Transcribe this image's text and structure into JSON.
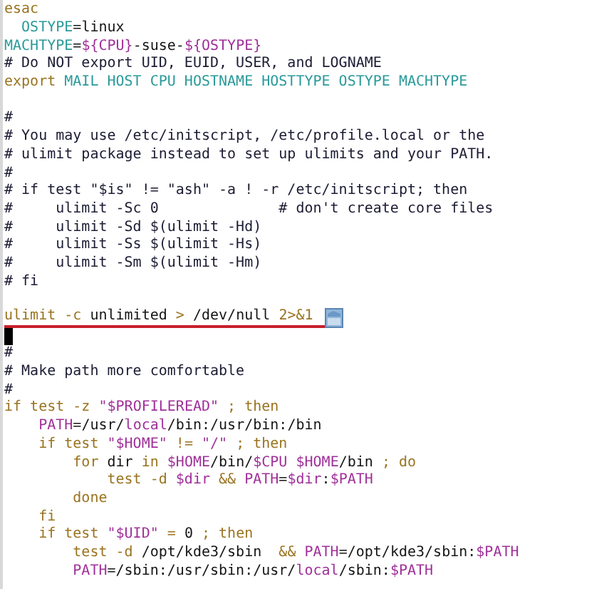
{
  "lines": [
    {
      "tokens": [
        {
          "text": "esac",
          "kind": "keyword"
        }
      ]
    },
    {
      "tokens": [
        {
          "text": "  OSTYPE",
          "kind": "variable"
        },
        {
          "text": "=linux",
          "kind": "plain"
        }
      ]
    },
    {
      "tokens": [
        {
          "text": "MACHTYPE",
          "kind": "variable"
        },
        {
          "text": "=",
          "kind": "plain"
        },
        {
          "text": "${CPU}",
          "kind": "expansion"
        },
        {
          "text": "-suse-",
          "kind": "plain"
        },
        {
          "text": "${OSTYPE}",
          "kind": "expansion"
        }
      ]
    },
    {
      "tokens": [
        {
          "text": "# Do NOT export UID, EUID, USER, and LOGNAME",
          "kind": "comment"
        }
      ]
    },
    {
      "tokens": [
        {
          "text": "export",
          "kind": "keyword"
        },
        {
          "text": " MAIL HOST CPU HOSTNAME HOSTTYPE OSTYPE MACHTYPE",
          "kind": "variable"
        }
      ]
    },
    {
      "kind": "blank"
    },
    {
      "tokens": [
        {
          "text": "#",
          "kind": "comment"
        }
      ]
    },
    {
      "tokens": [
        {
          "text": "# You may use /etc/initscript, /etc/profile.local or the",
          "kind": "comment"
        }
      ]
    },
    {
      "tokens": [
        {
          "text": "# ulimit package instead to set up ulimits and your PATH.",
          "kind": "comment"
        }
      ]
    },
    {
      "tokens": [
        {
          "text": "#",
          "kind": "comment"
        }
      ]
    },
    {
      "tokens": [
        {
          "text": "# if test \"$is\" != \"ash\" -a ! -r /etc/initscript; then",
          "kind": "comment"
        }
      ]
    },
    {
      "tokens": [
        {
          "text": "#     ulimit -Sc 0              # don't create core files",
          "kind": "comment"
        }
      ]
    },
    {
      "tokens": [
        {
          "text": "#     ulimit -Sd $(ulimit -Hd)",
          "kind": "comment"
        }
      ]
    },
    {
      "tokens": [
        {
          "text": "#     ulimit -Ss $(ulimit -Hs)",
          "kind": "comment"
        }
      ]
    },
    {
      "tokens": [
        {
          "text": "#     ulimit -Sm $(ulimit -Hm)",
          "kind": "comment"
        }
      ]
    },
    {
      "tokens": [
        {
          "text": "# fi",
          "kind": "comment"
        }
      ]
    },
    {
      "kind": "blank"
    },
    {
      "underlined": true,
      "marker": true,
      "tokens": [
        {
          "text": "ulimit",
          "kind": "keyword"
        },
        {
          "text": " -c",
          "kind": "keyword"
        },
        {
          "text": " unlimited ",
          "kind": "plain"
        },
        {
          "text": ">",
          "kind": "keyword"
        },
        {
          "text": " /dev/null ",
          "kind": "plain"
        },
        {
          "text": "2>&1",
          "kind": "keyword"
        }
      ]
    },
    {
      "kind": "cursor"
    },
    {
      "tokens": [
        {
          "text": "#",
          "kind": "comment"
        }
      ]
    },
    {
      "tokens": [
        {
          "text": "# Make path more comfortable",
          "kind": "comment"
        }
      ]
    },
    {
      "tokens": [
        {
          "text": "#",
          "kind": "comment"
        }
      ]
    },
    {
      "tokens": [
        {
          "text": "if test -z ",
          "kind": "keyword"
        },
        {
          "text": "\"$PROFILEREAD\"",
          "kind": "expansion"
        },
        {
          "text": " ; then",
          "kind": "keyword"
        }
      ]
    },
    {
      "tokens": [
        {
          "text": "    PATH",
          "kind": "expansion"
        },
        {
          "text": "=/usr/",
          "kind": "plain"
        },
        {
          "text": "local",
          "kind": "expansion"
        },
        {
          "text": "/bin:/usr/bin:/bin",
          "kind": "plain"
        }
      ]
    },
    {
      "tokens": [
        {
          "text": "    if test ",
          "kind": "keyword"
        },
        {
          "text": "\"$HOME\"",
          "kind": "expansion"
        },
        {
          "text": " != ",
          "kind": "keyword"
        },
        {
          "text": "\"/\"",
          "kind": "expansion"
        },
        {
          "text": " ; then",
          "kind": "keyword"
        }
      ]
    },
    {
      "tokens": [
        {
          "text": "        for",
          "kind": "keyword"
        },
        {
          "text": " dir ",
          "kind": "plain"
        },
        {
          "text": "in",
          "kind": "keyword"
        },
        {
          "text": " $HOME",
          "kind": "expansion"
        },
        {
          "text": "/bin/",
          "kind": "plain"
        },
        {
          "text": "$CPU",
          "kind": "expansion"
        },
        {
          "text": " $HOME",
          "kind": "expansion"
        },
        {
          "text": "/bin ",
          "kind": "plain"
        },
        {
          "text": "; do",
          "kind": "keyword"
        }
      ]
    },
    {
      "tokens": [
        {
          "text": "            test -d",
          "kind": "keyword"
        },
        {
          "text": " $dir",
          "kind": "expansion"
        },
        {
          "text": " &&",
          "kind": "keyword"
        },
        {
          "text": " PATH",
          "kind": "expansion"
        },
        {
          "text": "=",
          "kind": "plain"
        },
        {
          "text": "$dir",
          "kind": "expansion"
        },
        {
          "text": ":",
          "kind": "plain"
        },
        {
          "text": "$PATH",
          "kind": "expansion"
        }
      ]
    },
    {
      "tokens": [
        {
          "text": "        done",
          "kind": "keyword"
        }
      ]
    },
    {
      "tokens": [
        {
          "text": "    fi",
          "kind": "keyword"
        }
      ]
    },
    {
      "tokens": [
        {
          "text": "    if test ",
          "kind": "keyword"
        },
        {
          "text": "\"$UID\"",
          "kind": "expansion"
        },
        {
          "text": " = ",
          "kind": "keyword"
        },
        {
          "text": "0",
          "kind": "plain"
        },
        {
          "text": " ; then",
          "kind": "keyword"
        }
      ]
    },
    {
      "tokens": [
        {
          "text": "        test -d",
          "kind": "keyword"
        },
        {
          "text": " /opt/kde3/sbin  ",
          "kind": "plain"
        },
        {
          "text": "&&",
          "kind": "keyword"
        },
        {
          "text": " PATH",
          "kind": "expansion"
        },
        {
          "text": "=/opt/kde3/sbin:",
          "kind": "plain"
        },
        {
          "text": "$PATH",
          "kind": "expansion"
        }
      ]
    },
    {
      "tokens": [
        {
          "text": "        PATH",
          "kind": "expansion"
        },
        {
          "text": "=/sbin:/usr/sbin:/usr/",
          "kind": "plain"
        },
        {
          "text": "local",
          "kind": "expansion"
        },
        {
          "text": "/sbin:",
          "kind": "plain"
        },
        {
          "text": "$PATH",
          "kind": "expansion"
        }
      ]
    }
  ]
}
